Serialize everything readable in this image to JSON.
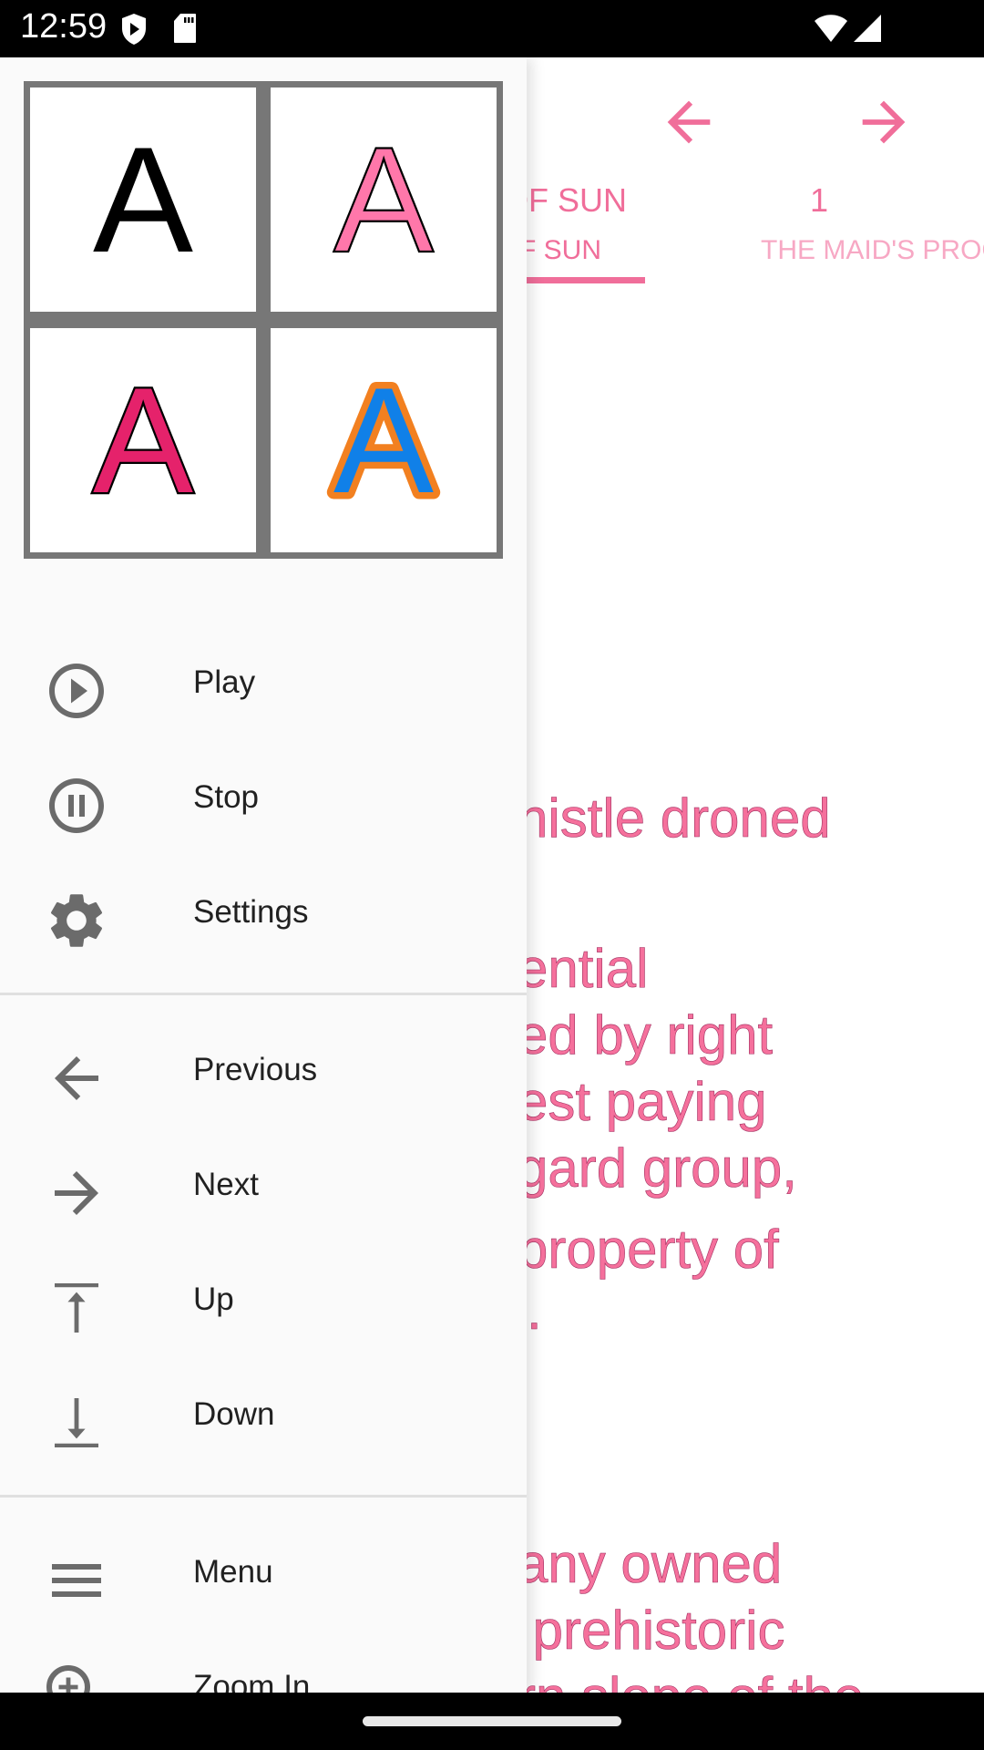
{
  "status_bar": {
    "time": "12:59",
    "left_icons": [
      "shield-play-icon",
      "sd-card-icon"
    ],
    "right_icons": [
      "wifi-icon",
      "cellular-signal-icon"
    ]
  },
  "reader": {
    "accent_color": "#f06e9a",
    "nav": {
      "previous_icon": "arrow-left-icon",
      "next_icon": "arrow-right-icon"
    },
    "tabs": [
      {
        "title": "OF SUN",
        "subtitle": "F SUN",
        "selected": true
      },
      {
        "title": "1",
        "subtitle": "THE MAID'S PROC",
        "selected": false
      }
    ],
    "text_lines": [
      "histle droned",
      "ential",
      "ed by right",
      "est paying",
      "gard group,",
      "property of",
      ".",
      "any owned",
      " prehistoric",
      "rn slope of the"
    ]
  },
  "drawer": {
    "font_previews": [
      {
        "letter": "A",
        "style": "plain-black",
        "fill": "#000000",
        "stroke": "none"
      },
      {
        "letter": "A",
        "style": "pink-outlined",
        "fill": "#ff77aa",
        "stroke": "#000000"
      },
      {
        "letter": "A",
        "style": "crimson-outlined",
        "fill": "#e5226b",
        "stroke": "#000000"
      },
      {
        "letter": "A",
        "style": "blue-orange-outlined",
        "fill": "#1080e8",
        "stroke": "#f28020"
      }
    ],
    "groups": [
      [
        {
          "label": "Play",
          "icon": "play-circle-icon"
        },
        {
          "label": "Stop",
          "icon": "pause-circle-icon"
        },
        {
          "label": "Settings",
          "icon": "gear-icon"
        }
      ],
      [
        {
          "label": "Previous",
          "icon": "arrow-left-icon"
        },
        {
          "label": "Next",
          "icon": "arrow-right-icon"
        },
        {
          "label": "Up",
          "icon": "arrow-up-to-top-icon"
        },
        {
          "label": "Down",
          "icon": "arrow-down-to-bottom-icon"
        }
      ],
      [
        {
          "label": "Menu",
          "icon": "hamburger-menu-icon"
        },
        {
          "label": "Zoom In",
          "icon": "zoom-in-icon"
        }
      ]
    ]
  }
}
